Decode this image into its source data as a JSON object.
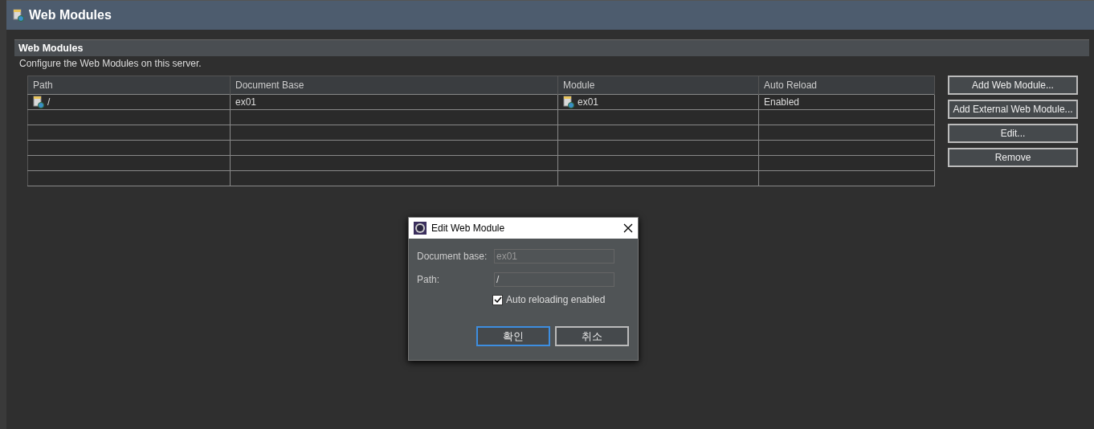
{
  "page_title": "Web Modules",
  "section": {
    "title": "Web Modules",
    "description": "Configure the Web Modules on this server."
  },
  "table": {
    "columns": [
      "Path",
      "Document Base",
      "Module",
      "Auto Reload"
    ],
    "rows": [
      {
        "cells": [
          "/",
          "ex01",
          "ex01",
          "Enabled"
        ]
      }
    ]
  },
  "buttons": [
    "Add Web Module...",
    "Add External Web Module...",
    "Edit...",
    "Remove"
  ],
  "dialog": {
    "title": "Edit Web Module",
    "fields": [
      {
        "label": "Document base:",
        "value": "ex01",
        "disabled": true
      },
      {
        "label": "Path:",
        "value": "/",
        "disabled": false
      }
    ],
    "checkbox": {
      "label": "Auto reloading enabled",
      "checked": true
    },
    "buttons": [
      {
        "label": "확인",
        "selected": true
      },
      {
        "label": "취소",
        "selected": false
      }
    ]
  }
}
